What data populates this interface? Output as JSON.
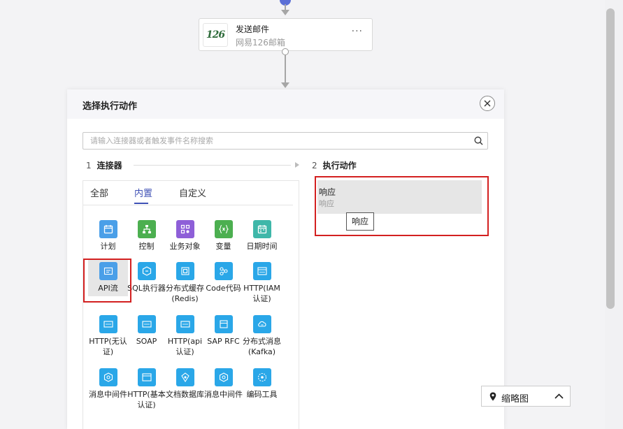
{
  "flow": {
    "email_node": {
      "logo_text": "126",
      "title": "发送邮件",
      "subtitle": "网易126邮箱",
      "more": "···"
    }
  },
  "dialog": {
    "title": "选择执行动作",
    "search_placeholder": "请输入连接器或者触发事件名称搜索",
    "steps": [
      {
        "num": "1",
        "label": "连接器"
      },
      {
        "num": "2",
        "label": "执行动作"
      }
    ],
    "tabs": [
      {
        "label": "全部",
        "active": false
      },
      {
        "label": "内置",
        "active": true
      },
      {
        "label": "自定义",
        "active": false
      }
    ],
    "connectors": [
      {
        "label": "计划",
        "icon": "calendar-icon",
        "color": "#4a9fe8"
      },
      {
        "label": "控制",
        "icon": "flow-control-icon",
        "color": "#4caf50"
      },
      {
        "label": "业务对象",
        "icon": "business-object-icon",
        "color": "#8e5fd8"
      },
      {
        "label": "变量",
        "icon": "variable-icon",
        "color": "#4caf50"
      },
      {
        "label": "日期时间",
        "icon": "date-time-icon",
        "color": "#3fb7a9"
      },
      {
        "label": "API流",
        "icon": "api-flow-icon",
        "color": "#4a9fe8"
      },
      {
        "label": "SQL执行器",
        "icon": "sql-executor-icon",
        "color": "#2aa7e8"
      },
      {
        "label": "分布式缓存(Redis)",
        "icon": "redis-cache-icon",
        "color": "#2aa7e8"
      },
      {
        "label": "Code代码",
        "icon": "code-icon",
        "color": "#2aa7e8"
      },
      {
        "label": "HTTP(IAM认证)",
        "icon": "http-iam-icon",
        "color": "#2aa7e8"
      },
      {
        "label": "HTTP(无认证)",
        "icon": "http-noauth-icon",
        "color": "#2aa7e8"
      },
      {
        "label": "SOAP",
        "icon": "soap-icon",
        "color": "#2aa7e8"
      },
      {
        "label": "HTTP(api认证)",
        "icon": "http-api-icon",
        "color": "#2aa7e8"
      },
      {
        "label": "SAP RFC",
        "icon": "sap-rfc-icon",
        "color": "#2aa7e8"
      },
      {
        "label": "分布式消息(Kafka)",
        "icon": "kafka-icon",
        "color": "#2aa7e8"
      },
      {
        "label": "消息中间件",
        "icon": "message-middleware-icon",
        "color": "#2aa7e8"
      },
      {
        "label": "HTTP(基本认证)",
        "icon": "http-basic-icon",
        "color": "#2aa7e8"
      },
      {
        "label": "文档数据库",
        "icon": "document-db-icon",
        "color": "#2aa7e8"
      },
      {
        "label": "消息中间件",
        "icon": "message-middleware-icon",
        "color": "#2aa7e8"
      },
      {
        "label": "编码工具",
        "icon": "encoding-tool-icon",
        "color": "#2aa7e8"
      }
    ],
    "selected_connector": "API流",
    "action": {
      "name": "响应",
      "subtitle": "响应",
      "tooltip": "响应"
    }
  },
  "thumbnail_button": {
    "label": "缩略图"
  }
}
